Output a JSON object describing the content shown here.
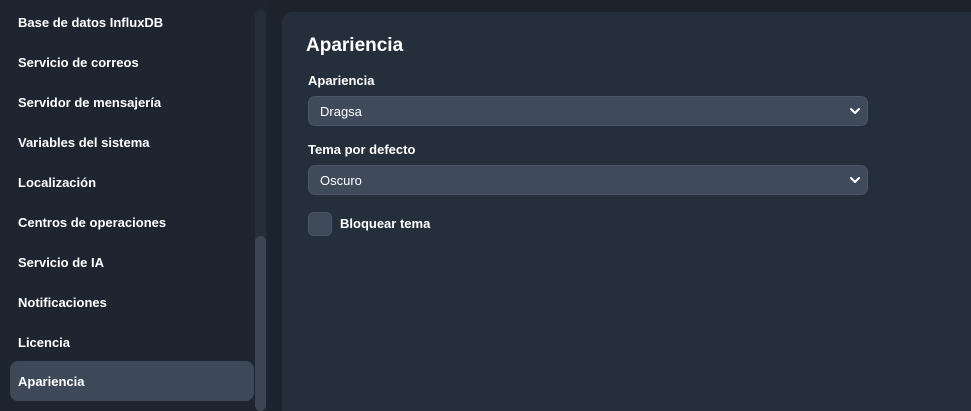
{
  "sidebar": {
    "items": [
      {
        "label": "Base de datos InfluxDB"
      },
      {
        "label": "Servicio de correos"
      },
      {
        "label": "Servidor de mensajería"
      },
      {
        "label": "Variables del sistema"
      },
      {
        "label": "Localización"
      },
      {
        "label": "Centros de operaciones"
      },
      {
        "label": "Servicio de IA"
      },
      {
        "label": "Notificaciones"
      },
      {
        "label": "Licencia"
      },
      {
        "label": "Apariencia"
      }
    ],
    "active_item": "Apariencia"
  },
  "main": {
    "title": "Apariencia",
    "appearance_field": {
      "label": "Apariencia",
      "value": "Dragsa"
    },
    "default_theme_field": {
      "label": "Tema por defecto",
      "value": "Oscuro"
    },
    "lock_theme": {
      "label": "Bloquear tema",
      "checked": false
    }
  },
  "colors": {
    "background": "#1c232d",
    "sidebar_active": "#3d4858",
    "panel": "#252e3b",
    "input": "#3f4a5b"
  }
}
